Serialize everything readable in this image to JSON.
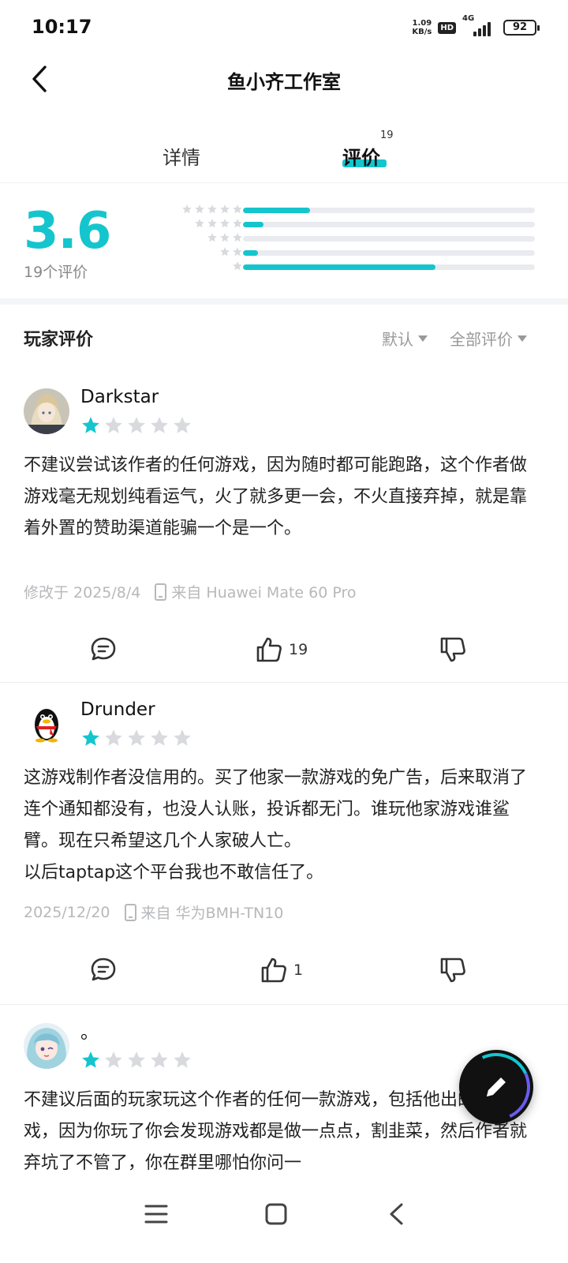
{
  "status_bar": {
    "time": "10:17",
    "net_speed_value": "1.09",
    "net_speed_unit": "KB/s",
    "hd": "HD",
    "network": "4G",
    "battery": "92"
  },
  "header": {
    "title": "鱼小齐工作室"
  },
  "tabs": [
    {
      "label": "详情",
      "active": false
    },
    {
      "label": "评价",
      "active": true,
      "count": "19"
    }
  ],
  "rating": {
    "score": "3.6",
    "count_label": "19个评价",
    "distribution": [
      {
        "stars": 5,
        "fraction": 0.23
      },
      {
        "stars": 4,
        "fraction": 0.07
      },
      {
        "stars": 3,
        "fraction": 0.0
      },
      {
        "stars": 2,
        "fraction": 0.05
      },
      {
        "stars": 1,
        "fraction": 0.66
      }
    ]
  },
  "filters": {
    "title": "玩家评价",
    "sort": "默认",
    "scope": "全部评价"
  },
  "reviews": [
    {
      "username": "Darkstar",
      "rating": 1,
      "body": "不建议尝试该作者的任何游戏，因为随时都可能跑路，这个作者做游戏毫无规划纯看运气，火了就多更一会，不火直接弃掉，就是靠着外置的赞助渠道能骗一个是一个。",
      "date": "修改于 2025/8/4",
      "device": "来自 Huawei Mate 60 Pro",
      "likes": "19"
    },
    {
      "username": "Drunder",
      "rating": 1,
      "body_lines": [
        "这游戏制作者没信用的。买了他家一款游戏的免广告，后来取消了连个通知都没有，也没人认账，投诉都无门。谁玩他家游戏谁鲨臂。现在只希望这几个人家破人亡。",
        "以后taptap这个平台我也不敢信任了。"
      ],
      "date": "2025/12/20",
      "device": "来自 华为BMH-TN10",
      "likes": "1"
    },
    {
      "username": "。",
      "rating": 1,
      "body": "不建议后面的玩家玩这个作者的任何一款游戏，包括他出的任何游戏，因为你玩了你会发现游戏都是做一点点，割韭菜，然后作者就弃坑了不管了，你在群里哪怕你问一"
    }
  ],
  "colors": {
    "accent": "#15c5ce",
    "star_empty": "#d8dadd",
    "meta_text": "#b6b8bb"
  },
  "icons": {
    "back": "chevron-left-icon",
    "comment": "comment-icon",
    "like": "thumbs-up-icon",
    "dislike": "thumbs-down-icon",
    "fab": "pencil-icon",
    "nav_menu": "menu-icon",
    "nav_home": "square-icon",
    "nav_back": "triangle-back-icon"
  }
}
